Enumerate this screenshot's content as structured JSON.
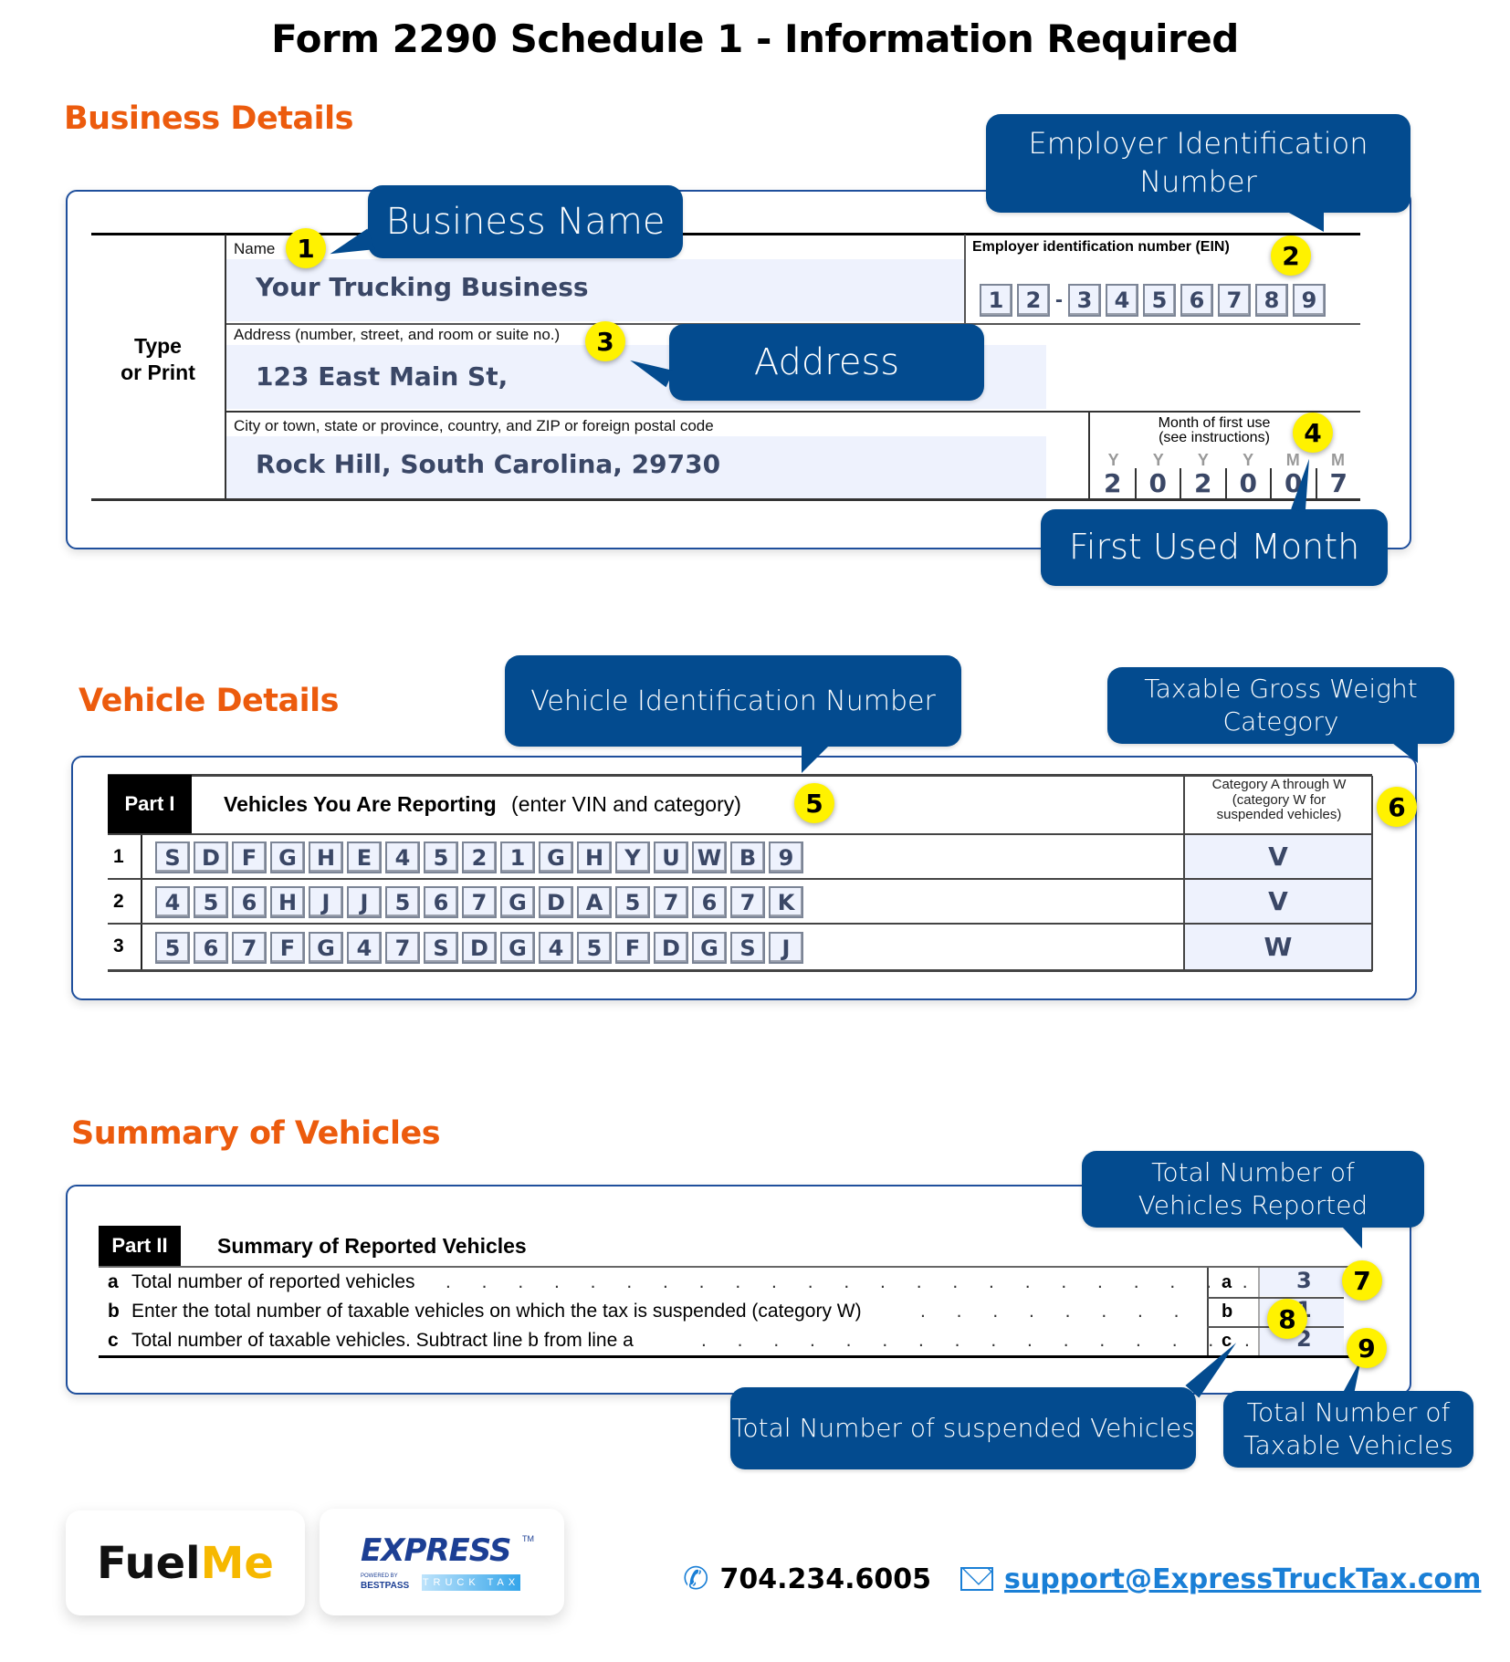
{
  "title": "Form 2290 Schedule 1 - Information Required",
  "colors": {
    "accent_orange": "#ec5b0d",
    "callout_blue": "#034b8f",
    "badge_yellow": "#fff200",
    "panel_border": "#1f4f9c",
    "field_fill": "#eef2fd",
    "link_blue": "#1a7fd6"
  },
  "business": {
    "heading": "Business Details",
    "type_or_print": [
      "Type",
      "or Print"
    ],
    "name_label": "Name",
    "name_value": "Your Trucking Business",
    "address_label": "Address (number, street, and room or suite no.)",
    "address_value": "123 East Main St,",
    "city_label": "City or town, state or province, country, and ZIP or foreign postal code",
    "city_value": "Rock Hill, South Carolina, 29730",
    "ein_label": "Employer identification number (EIN)",
    "ein_digits": [
      "1",
      "2",
      "3",
      "4",
      "5",
      "6",
      "7",
      "8",
      "9"
    ],
    "ein_separator": "-",
    "month_label_line1": "Month of first use",
    "month_label_line2": "(see instructions)",
    "month_headers": [
      "Y",
      "Y",
      "Y",
      "Y",
      "M",
      "M"
    ],
    "month_digits": [
      "2",
      "0",
      "2",
      "0",
      "0",
      "7"
    ],
    "callouts": {
      "name": "Business Name",
      "ein": "Employer Identification Number",
      "address": "Address",
      "month": "First Used Month"
    },
    "badges": [
      "1",
      "2",
      "3",
      "4"
    ]
  },
  "vehicles": {
    "heading": "Vehicle Details",
    "part_label": "Part I",
    "part_title": "Vehicles You Are Reporting",
    "part_subtitle": "(enter VIN and category)",
    "category_header": [
      "Category A through W",
      "(category W for",
      "suspended vehicles)"
    ],
    "rows": [
      {
        "num": "1",
        "vin": [
          "S",
          "D",
          "F",
          "G",
          "H",
          "E",
          "4",
          "5",
          "2",
          "1",
          "G",
          "H",
          "Y",
          "U",
          "W",
          "B",
          "9"
        ],
        "category": "V"
      },
      {
        "num": "2",
        "vin": [
          "4",
          "5",
          "6",
          "H",
          "J",
          "J",
          "5",
          "6",
          "7",
          "G",
          "D",
          "A",
          "5",
          "7",
          "6",
          "7",
          "K"
        ],
        "category": "V"
      },
      {
        "num": "3",
        "vin": [
          "5",
          "6",
          "7",
          "F",
          "G",
          "4",
          "7",
          "S",
          "D",
          "G",
          "4",
          "5",
          "F",
          "D",
          "G",
          "S",
          "J"
        ],
        "category": "W"
      }
    ],
    "callouts": {
      "vin": "Vehicle Identification Number",
      "category": "Taxable Gross Weight Category"
    },
    "badges": [
      "5",
      "6"
    ]
  },
  "summary": {
    "heading": "Summary of Vehicles",
    "part_label": "Part II",
    "part_title": "Summary of Reported Vehicles",
    "lines": [
      {
        "letter": "a",
        "text": "Total number of reported vehicles",
        "value": "3"
      },
      {
        "letter": "b",
        "text": "Enter the total number of taxable vehicles on which the tax is suspended (category W)",
        "value": "1"
      },
      {
        "letter": "c",
        "text": "Total number of taxable vehicles. Subtract line b from line a",
        "value": "2"
      }
    ],
    "callouts": {
      "reported": "Total Number of Vehicles Reported",
      "suspended": "Total Number of suspended Vehicles",
      "taxable": "Total Number of Taxable Vehicles"
    },
    "badges": [
      "7",
      "8",
      "9"
    ]
  },
  "footer": {
    "logo_fuelme": {
      "part1": "Fuel",
      "part2": "Me"
    },
    "logo_express": {
      "main": "EXPRESS",
      "tm": "TM",
      "sub": "TRUCK TAX",
      "powered": "POWERED BY",
      "bestpass": "BESTPASS"
    },
    "phone_icon": "phone-icon",
    "phone": "704.234.6005",
    "email_icon": "envelope-icon",
    "email": "support@ExpressTruckTax.com"
  }
}
